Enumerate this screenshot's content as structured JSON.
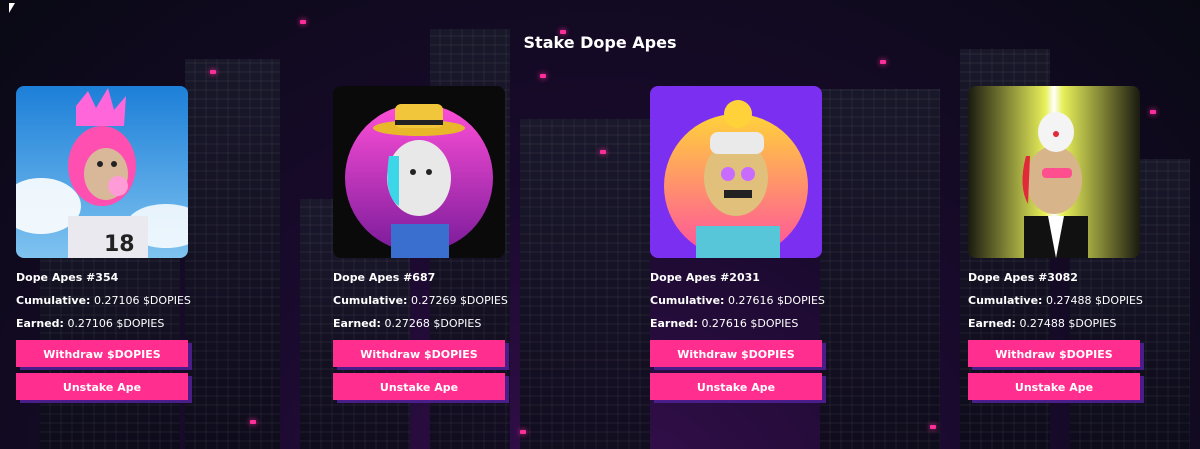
{
  "page": {
    "title": "Stake Dope Apes"
  },
  "colors": {
    "accent": "#ff2e8f",
    "shadow": "#4a1d8a",
    "background": "#0c0b17"
  },
  "cards": [
    {
      "name": "Dope Apes #354",
      "cumulative_label": "Cumulative:",
      "cumulative": "0.27106 $DOPIES",
      "earned_label": "Earned:",
      "earned": "0.27106 $DOPIES",
      "withdraw": "Withdraw $DOPIES",
      "unstake": "Unstake Ape"
    },
    {
      "name": "Dope Apes #687",
      "cumulative_label": "Cumulative:",
      "cumulative": "0.27269 $DOPIES",
      "earned_label": "Earned:",
      "earned": "0.27268 $DOPIES",
      "withdraw": "Withdraw $DOPIES",
      "unstake": "Unstake Ape"
    },
    {
      "name": "Dope Apes #2031",
      "cumulative_label": "Cumulative:",
      "cumulative": "0.27616 $DOPIES",
      "earned_label": "Earned:",
      "earned": "0.27616 $DOPIES",
      "withdraw": "Withdraw $DOPIES",
      "unstake": "Unstake Ape"
    },
    {
      "name": "Dope Apes #3082",
      "cumulative_label": "Cumulative:",
      "cumulative": "0.27488 $DOPIES",
      "earned_label": "Earned:",
      "earned": "0.27488 $DOPIES",
      "withdraw": "Withdraw $DOPIES",
      "unstake": "Unstake Ape"
    }
  ]
}
